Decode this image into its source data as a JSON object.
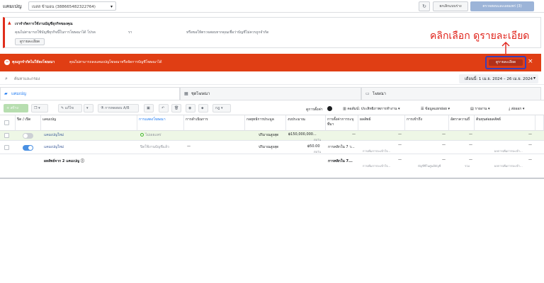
{
  "topbar": {
    "title": "แคมเปญ",
    "account": "เบสส ข้ามอน (388665482322764)",
    "discard_label": "ยกเลิกแบบร่าง",
    "review_label": "ตรวจสอบและเผยแพร่ (3)"
  },
  "warning": {
    "heading": "เราจำกัดการใช้งานบัญชีธุรกิจของคุณ",
    "body_a": "คุณไม่สามารถใช้บัญชีธุรกิจนี้ในการโฆษณาได้ โปรด",
    "body_b": "รา",
    "body_c": "หรือขอให้ตรวจสอบหากคุณเชื่อว่าบัญชีไม่ควรถูกจำกัด",
    "more_label": "ดูรายละเอียด"
  },
  "annotation": {
    "text": "คลิกเลือก ดูรายละเอียด",
    "color": "#e0231b"
  },
  "banner": {
    "title": "คุณถูกจำกัดไม่ให้ลงโฆษณา",
    "message": "คุณไม่สามารถลงแคมเปญโฆษณาหรือจัดการบัญชีโฆษณาได้",
    "details_label": "ดูรายละเอียด",
    "color": "#e03e14"
  },
  "search": {
    "placeholder": "ค้นหาและกรอง"
  },
  "date_range": "เดือนนี้: 1 เม.ย. 2024 – 26 เม.ย. 2024",
  "tabs": [
    {
      "label": "แคมเปญ"
    },
    {
      "label": "ชุดโฆษณา"
    },
    {
      "label": "โฆษณา"
    }
  ],
  "toolbar": {
    "create": "+ สร้าง",
    "edit": "แก้ไข",
    "ab_test": "การทดสอบ A/B",
    "rules": "กฎ",
    "view_setup": "ดูการตั้งค่า",
    "columns": "คอลัมน์: ประสิทธิภาพการทำงาน",
    "breakdown": "ข้อมูลแยกย่อย",
    "reports": "รายงาน",
    "export": "ส่งออก"
  },
  "table": {
    "headers": {
      "onoff": "ปิด / เปิด",
      "campaign": "แคมเปญ",
      "delivery": "การแสดงโฆษณา",
      "actions": "การดำเนินการ",
      "bid_strategy": "กลยุทธ์การประมูล",
      "budget": "งบประมาณ",
      "attribution": "การตั้งค่าการระบุที่มา",
      "results": "ผลลัพธ์",
      "reach": "การเข้าถึง",
      "frequency": "อัตราความถี่",
      "cost_per_result": "ต้นทุนต่อผลลัพธ์"
    },
    "rows": [
      {
        "name": "แคมเปญใหม่",
        "delivery": "ไม่เผยแพร่",
        "actions": "",
        "bid": "ปริมาณสูงสุด",
        "budget": "฿150,000,000...",
        "budget_sub": "ต่อวัน",
        "attribution": "—",
        "results": "—",
        "reach": "—",
        "frequency": "—",
        "cpr": "—"
      },
      {
        "name": "แคมเปญใหม่",
        "delivery": "ปิดใช้งานบัญชีแล้ว",
        "actions": "—",
        "bid": "ปริมาณสูงสุด",
        "budget": "฿50.00",
        "budget_sub": "ต่อวัน",
        "attribution": "การคลิกใน 7 ว...",
        "results": "—",
        "results_sub": "การเพิ่มการจะเข้าใจ...",
        "reach": "—",
        "frequency": "—",
        "cpr": "—",
        "cpr_sub": "ผลการเพิ่มการจะเข้า..."
      }
    ],
    "summary": {
      "label": "ผลลัพธ์จาก 2 แคมเปญ",
      "attribution": "การคลิกใน 7...",
      "results": "—",
      "results_sub": "การเพิ่มการจะเข้าใจ...",
      "reach": "—",
      "reach_sub": "บัญชีชีในศูนย์บัญชี",
      "frequency": "—",
      "frequency_sub": "รวม",
      "cpr": "—",
      "cpr_sub": "ผลการเพิ่มการจะเข้า..."
    }
  }
}
